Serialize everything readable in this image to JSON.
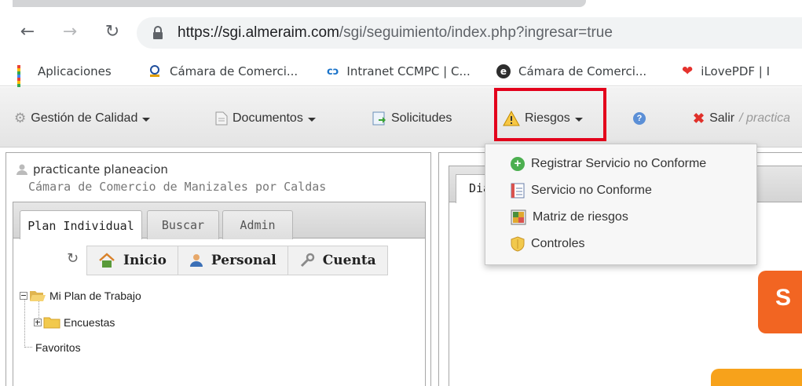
{
  "browser": {
    "url_host": "https://sgi.almeraim.com",
    "url_path": "/sgi/seguimiento/index.php?ingresar=true",
    "bookmarks": [
      {
        "label": "Aplicaciones",
        "icon": "apps-grid-icon"
      },
      {
        "label": "Cámara de Comerci...",
        "icon": "chamber-logo-icon"
      },
      {
        "label": "Intranet CCMPC | C...",
        "icon": "intranet-logo-icon"
      },
      {
        "label": "Cámara de Comerci...",
        "icon": "e-circle-icon"
      },
      {
        "label": "iLovePDF | I",
        "icon": "heart-icon"
      }
    ]
  },
  "menubar": {
    "gestion": "Gestión de Calidad",
    "documentos": "Documentos",
    "solicitudes": "Solicitudes",
    "riesgos": "Riesgos",
    "salir": "Salir",
    "user_suffix": "/ practica"
  },
  "dropdown": {
    "items": [
      {
        "label": "Registrar Servicio no Conforme",
        "icon": "green-plus-icon"
      },
      {
        "label": "Servicio no Conforme",
        "icon": "form-icon"
      },
      {
        "label": "Matriz de riesgos",
        "icon": "matrix-icon"
      },
      {
        "label": "Controles",
        "icon": "shield-icon"
      }
    ]
  },
  "left_panel": {
    "user": "practicante planeacion",
    "organization": "Cámara de Comercio de Manizales por Caldas",
    "tabs": [
      "Plan Individual",
      "Buscar",
      "Admin"
    ],
    "subnav": [
      "Inicio",
      "Personal",
      "Cuenta"
    ],
    "tree": {
      "root": "Mi Plan de Trabajo",
      "child": "Encuestas",
      "favorites": "Favoritos"
    }
  },
  "right_panel": {
    "tab_label": "Dia",
    "orange_text": "S"
  },
  "colors": {
    "highlight": "#e3001b",
    "orange": "#f26522",
    "orange_light": "#f7a21b"
  }
}
